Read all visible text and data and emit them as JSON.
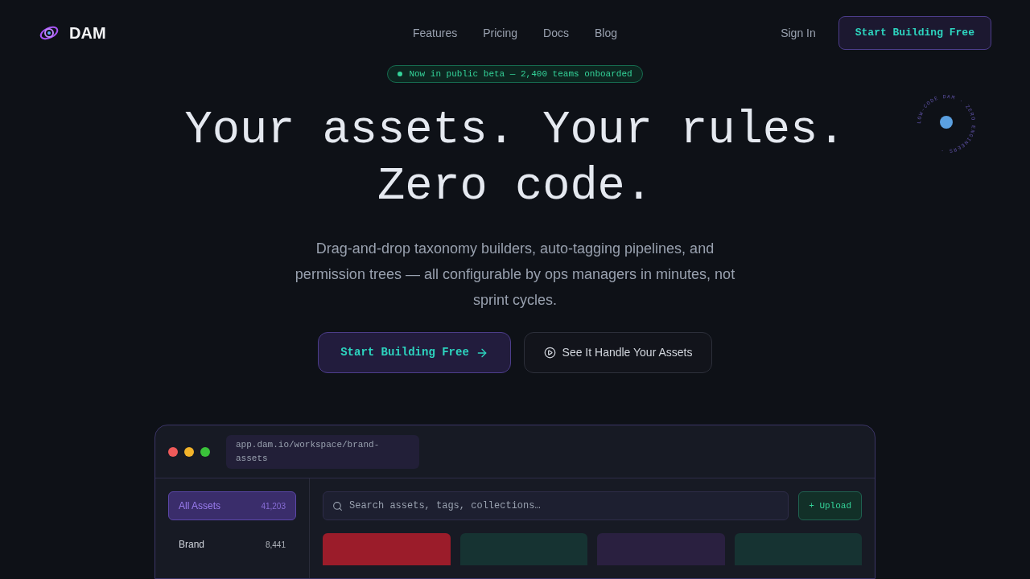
{
  "nav": {
    "brand": "DAM",
    "links": [
      "Features",
      "Pricing",
      "Docs",
      "Blog"
    ],
    "sign_in": "Sign In",
    "cta": "Start Building Free"
  },
  "beta_pill": "Now in public beta — 2,400 teams onboarded",
  "rotating_badge": "LOW-CODE DAM · ZERO ENGINEERS · ",
  "headline": [
    "Your assets. Your rules.",
    "Zero code."
  ],
  "subtitle": "Drag-and-drop taxonomy builders, auto-tagging pipelines, and permission trees — all configurable by ops managers in minutes, not sprint cycles.",
  "primary_button": "Start Building Free",
  "secondary_button": "See It Handle Your Assets",
  "app_window": {
    "url": "app.dam.io/workspace/brand-assets",
    "sidebar": [
      {
        "label": "All Assets",
        "count": "41,203",
        "selected": true
      },
      {
        "label": "Brand",
        "count": "8,441",
        "selected": false
      }
    ],
    "search_placeholder": "Search assets, tags, collections…",
    "upload": "+ Upload",
    "tiles": [
      {
        "color": "#9b1c2a"
      },
      {
        "color": "#163332"
      },
      {
        "color": "#2a2040"
      },
      {
        "color": "#163332"
      }
    ]
  }
}
